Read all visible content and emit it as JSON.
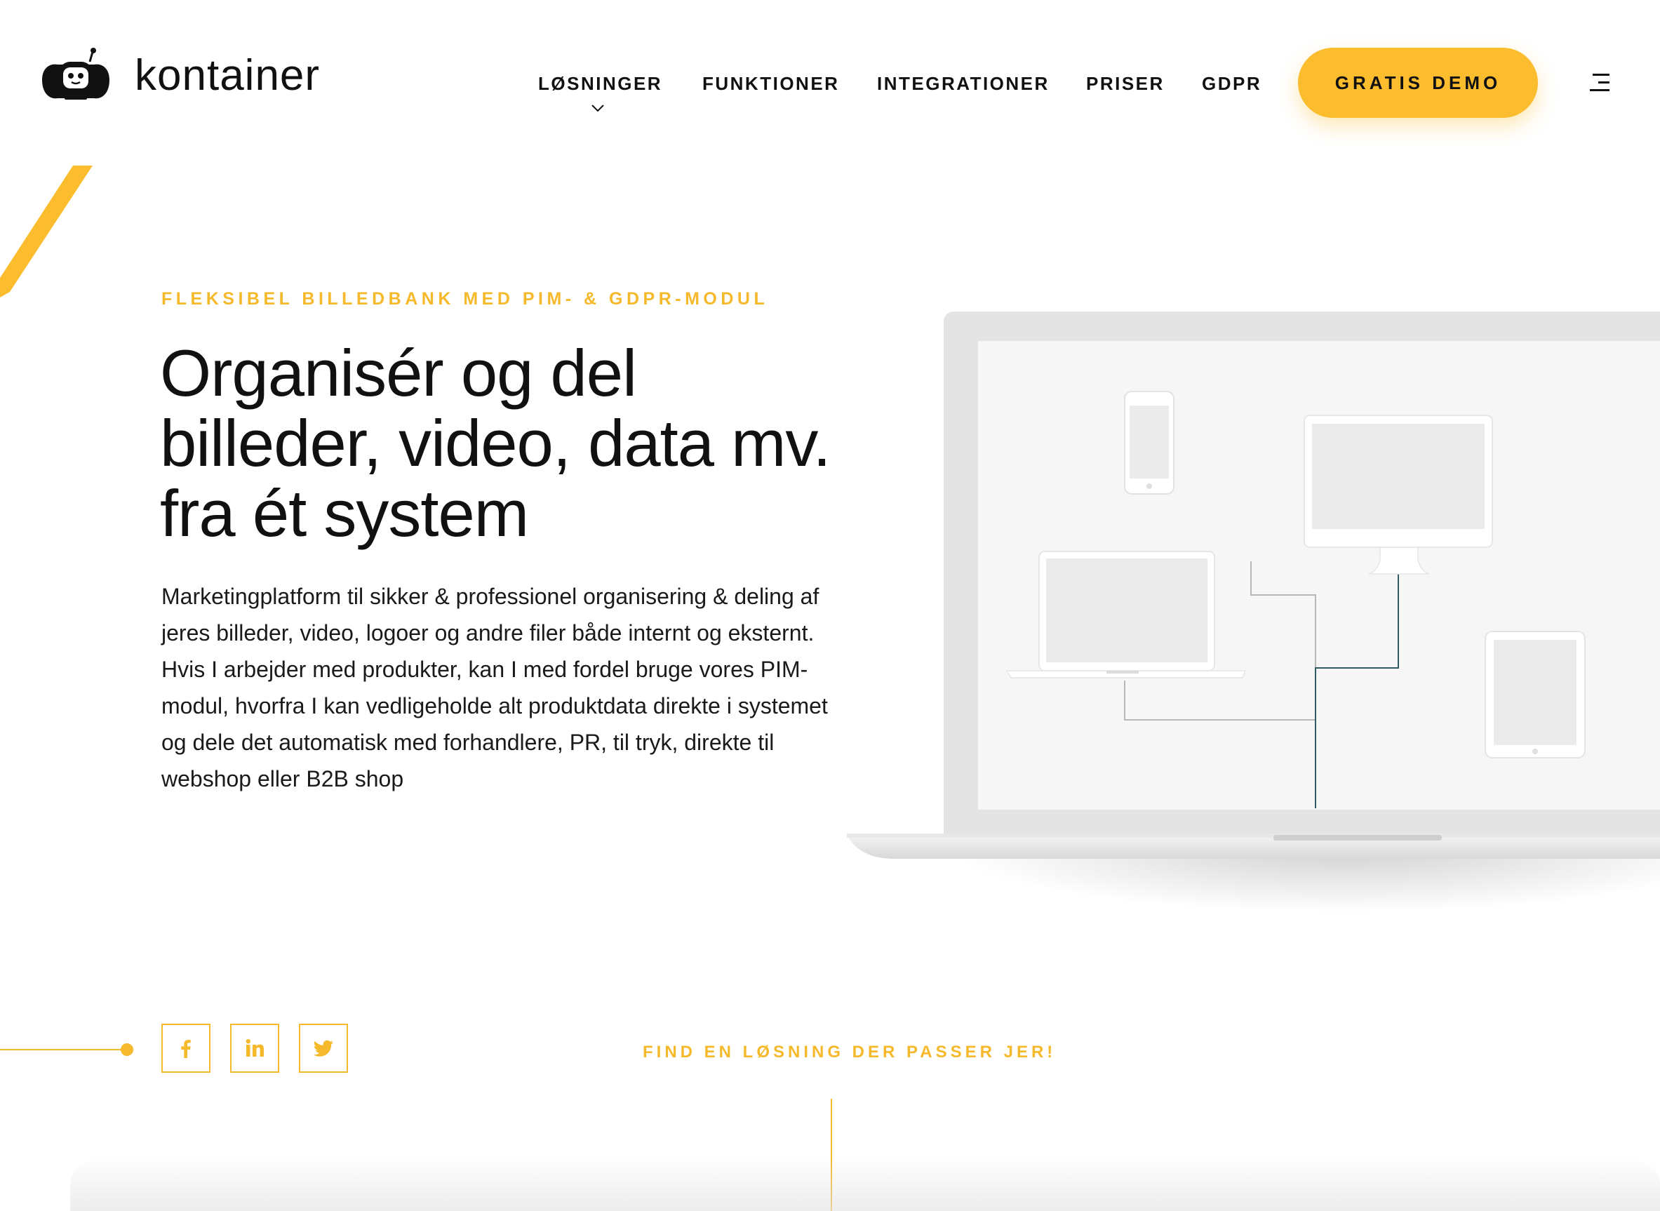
{
  "brand": {
    "name": "kontainer",
    "logo_icon": "robot-logo-icon"
  },
  "nav": {
    "items": [
      {
        "label": "LØSNINGER",
        "has_dropdown": true
      },
      {
        "label": "FUNKTIONER"
      },
      {
        "label": "INTEGRATIONER"
      },
      {
        "label": "PRISER"
      },
      {
        "label": "GDPR"
      }
    ],
    "cta_label": "GRATIS DEMO",
    "menu_icon": "hamburger-menu-icon"
  },
  "hero": {
    "eyebrow": "FLEKSIBEL BILLEDBANK MED PIM- & GDPR-MODUL",
    "headline_lines": [
      "Organisér og del",
      "billeder, video, data mv.",
      "fra ét system"
    ],
    "body_paragraph_1": "Marketingplatform til sikker & professionel organisering & deling af jeres billeder, video, logoer og andre filer både internt og eksternt.",
    "body_paragraph_2": "Hvis I arbejder med produkter, kan I med fordel bruge vores PIM-modul, hvorfra I kan vedligeholde alt produktdata direkte i systemet og dele det automatisk med forhandlere, PR, til tryk, direkte til webshop eller B2B shop"
  },
  "social": {
    "items": [
      {
        "icon": "facebook-icon"
      },
      {
        "icon": "linkedin-icon"
      },
      {
        "icon": "twitter-icon"
      }
    ]
  },
  "find_solution_label": "FIND EN LØSNING DER PASSER JER!",
  "colors": {
    "accent": "#fbbd2e",
    "accent_text": "#f6b92b",
    "text": "#111111",
    "connector": "#2f5d62"
  }
}
